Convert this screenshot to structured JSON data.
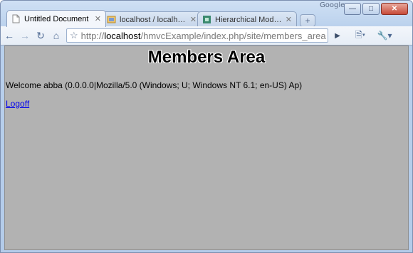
{
  "window": {
    "brand": "Google"
  },
  "tabs": [
    {
      "title": "Untitled Document",
      "icon": "page-icon",
      "active": true
    },
    {
      "title": "localhost / localhost...",
      "icon": "phpmyadmin-icon",
      "active": false
    },
    {
      "title": "Hierarchical Model ...",
      "icon": "site-icon",
      "active": false
    }
  ],
  "toolbar": {
    "url_scheme": "http://",
    "url_host": "localhost",
    "url_path": "/hmvcExample/index.php/site/members_area"
  },
  "page": {
    "heading": "Members Area",
    "welcome": "Welcome abba (0.0.0.0|Mozilla/5.0 (Windows; U; Windows NT 6.1; en-US) Ap)",
    "logoff": "Logoff"
  }
}
